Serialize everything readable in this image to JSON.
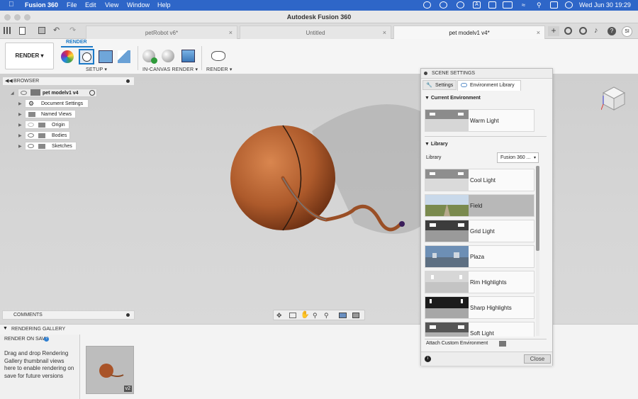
{
  "menubar": {
    "app": "Fusion 360",
    "items": [
      "File",
      "Edit",
      "View",
      "Window",
      "Help"
    ],
    "clock": "Wed Jun 30  19:29"
  },
  "window": {
    "title": "Autodesk Fusion 360"
  },
  "tabs": [
    {
      "label": "petRobot v6*"
    },
    {
      "label": "Untitled"
    },
    {
      "label": "pet modelv1 v4*"
    }
  ],
  "user": {
    "initials": "SI"
  },
  "ribbon": {
    "workspace": "RENDER ▾",
    "active_tab": "RENDER",
    "groups": {
      "setup": "SETUP ▾",
      "incanvas": "IN-CANVAS RENDER ▾",
      "render": "RENDER ▾"
    }
  },
  "browser": {
    "title": "BROWSER",
    "root": "pet modelv1 v4",
    "items": [
      "Document Settings",
      "Named Views",
      "Origin",
      "Bodies",
      "Sketches"
    ]
  },
  "comments": {
    "title": "COMMENTS"
  },
  "gallery": {
    "title": "RENDERING GALLERY",
    "render_on_save": "RENDER ON SAVE",
    "hint": "Drag and drop Rendering Gallery thumbnail views here to enable rendering on save for future versions",
    "thumb_badge": "v2"
  },
  "scene": {
    "title": "SCENE SETTINGS",
    "tab_settings": "Settings",
    "tab_env": "Environment Library",
    "current_heading": "Current Environment",
    "current": "Warm Light",
    "library_heading": "Library",
    "library_label": "Library",
    "library_select": "Fusion 360 ...",
    "environments": [
      "Cool Light",
      "Field",
      "Grid Light",
      "Plaza",
      "Rim Highlights",
      "Sharp Highlights",
      "Soft Light"
    ],
    "attach": "Attach Custom Environment",
    "close": "Close"
  }
}
